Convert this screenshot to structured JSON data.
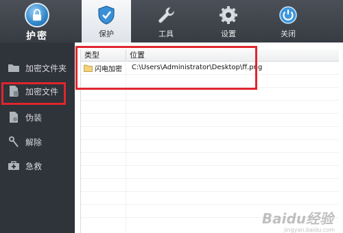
{
  "app": {
    "logo_label": "护密"
  },
  "tabs": [
    {
      "label": "保护",
      "icon": "shield-icon",
      "active": true
    },
    {
      "label": "工具",
      "icon": "wrench-icon",
      "active": false
    },
    {
      "label": "设置",
      "icon": "gear-icon",
      "active": false
    },
    {
      "label": "关闭",
      "icon": "power-icon",
      "active": false
    }
  ],
  "sidebar": {
    "items": [
      {
        "label": "加密文件夹",
        "icon": "folder-icon"
      },
      {
        "label": "加密文件",
        "icon": "file-icon"
      },
      {
        "label": "伪装",
        "icon": "disguise-icon"
      },
      {
        "label": "解除",
        "icon": "unlock-key-icon"
      },
      {
        "label": "急救",
        "icon": "first-aid-icon"
      }
    ]
  },
  "table": {
    "columns": [
      "类型",
      "位置"
    ],
    "rows": [
      {
        "type": "闪电加密",
        "location": "C:\\Users\\Administrator\\Desktop\\ff.png",
        "icon": "folder-icon"
      }
    ]
  },
  "watermark": {
    "text": "Baidu经验",
    "sub": "jingyan.baidu.com"
  },
  "colors": {
    "highlight": "#e0262c",
    "accent": "#2f86c9"
  }
}
